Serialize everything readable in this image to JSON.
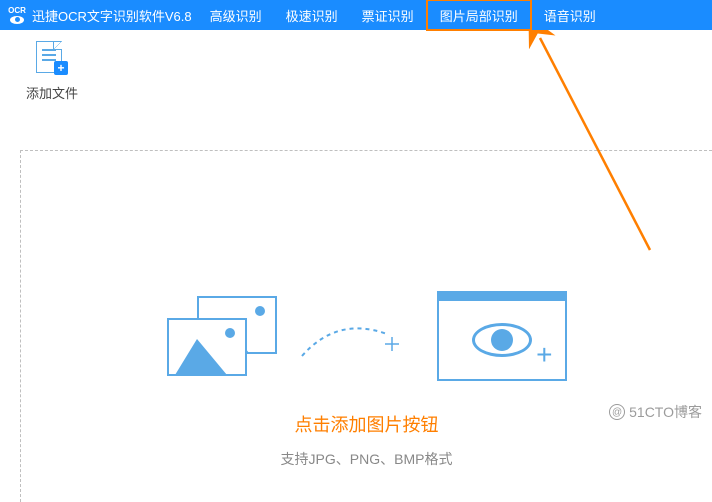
{
  "header": {
    "app_title": "迅捷OCR文字识别软件V6.8",
    "tabs": [
      {
        "label": "高级识别"
      },
      {
        "label": "极速识别"
      },
      {
        "label": "票证识别"
      },
      {
        "label": "图片局部识别"
      },
      {
        "label": "语音识别"
      }
    ],
    "highlighted_tab_index": 3
  },
  "toolbar": {
    "add_file_label": "添加文件"
  },
  "content": {
    "caption_main": "点击添加图片按钮",
    "caption_sub": "支持JPG、PNG、BMP格式"
  },
  "watermark": {
    "text": "51CTO博客"
  },
  "icons": {
    "logo_text": "OCR",
    "file_plus": "+"
  }
}
